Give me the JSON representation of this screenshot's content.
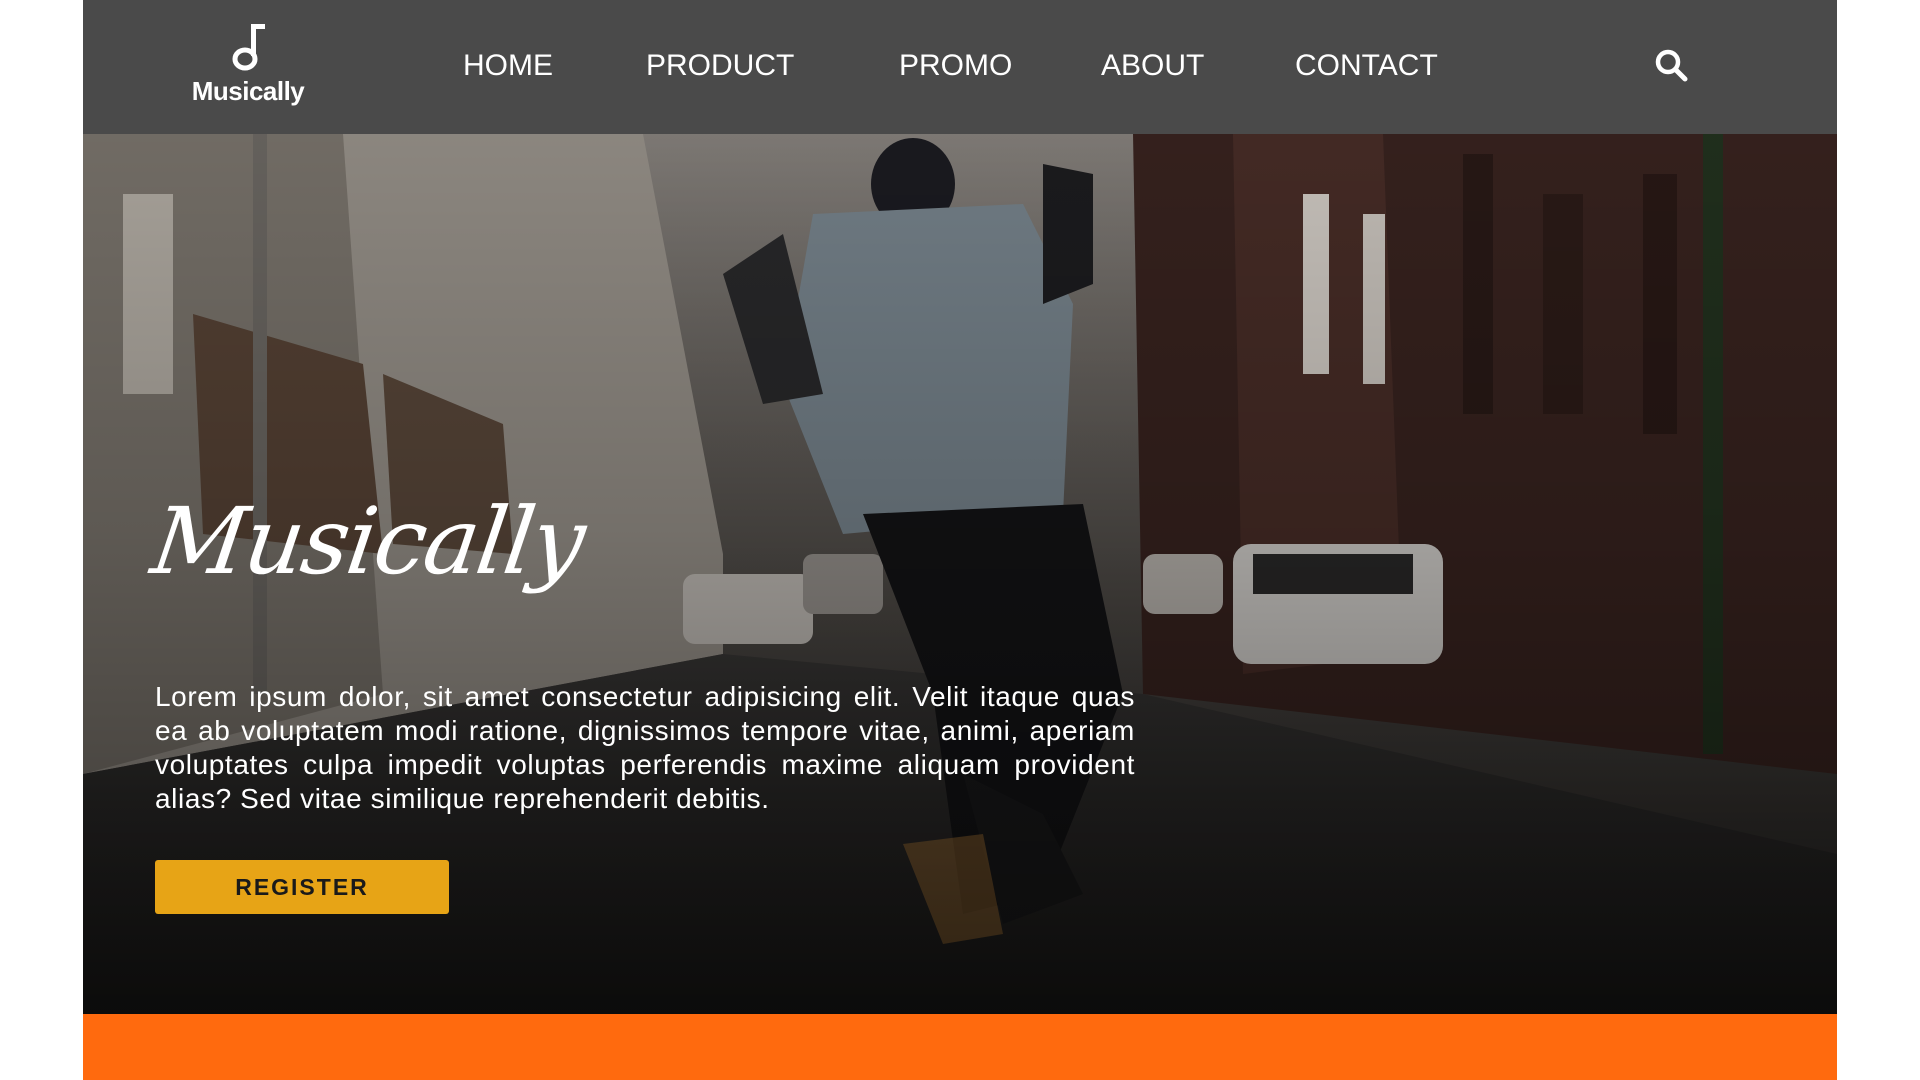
{
  "brand": {
    "name": "Musically",
    "icon": "music-note-icon"
  },
  "nav": {
    "items": [
      {
        "label": "HOME"
      },
      {
        "label": "PRODUCT"
      },
      {
        "label": "PROMO"
      },
      {
        "label": "ABOUT"
      },
      {
        "label": "CONTACT"
      }
    ],
    "search_icon": "search-icon"
  },
  "hero": {
    "title": "Musically",
    "text": "Lorem ipsum dolor, sit amet consectetur adipisicing elit. Velit itaque quas ea ab voluptatem modi ratione, dignissimos tempore vitae, animi, aperiam voluptates culpa impedit voluptas perferendis maxime aliquam provident alias? Sed vitae similique reprehenderit debitis.",
    "register_label": "REGISTER"
  },
  "colors": {
    "navbar": "#4a4a4a",
    "accent_button": "#e7a416",
    "bottom_band": "#ff6a0e"
  }
}
